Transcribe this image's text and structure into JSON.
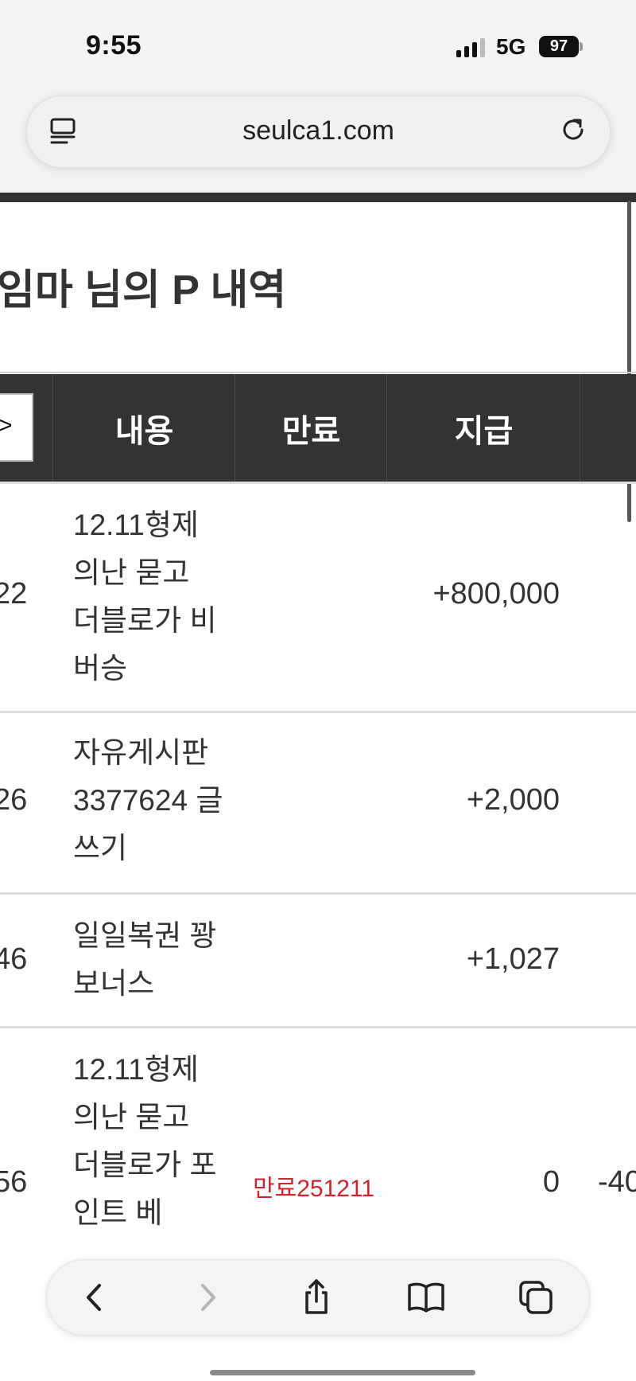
{
  "status_bar": {
    "time": "9:55",
    "network": "5G",
    "battery": "97"
  },
  "browser": {
    "url": "seulca1.com"
  },
  "page": {
    "title": "임마 님의 P 내역"
  },
  "table": {
    "headers": [
      "내용",
      "만료",
      "지급"
    ],
    "rows": [
      {
        "num": "22",
        "content": "12.11형제의난 묻고 더블로가 비버승",
        "expire": "",
        "amount": "+800,000",
        "extra": ""
      },
      {
        "num": "26",
        "content": "자유게시판 3377624 글쓰기",
        "expire": "",
        "amount": "+2,000",
        "extra": ""
      },
      {
        "num": "46",
        "content": "일일복권 꽝 보너스",
        "expire": "",
        "amount": "+1,027",
        "extra": ""
      },
      {
        "num": "56",
        "content": "12.11형제의난 묻고 더블로가 포인트 베",
        "expire": "만료251211",
        "amount": "0",
        "extra": "-40"
      }
    ]
  },
  "icons": {
    "reader": "reader-icon",
    "reload": "reload-icon",
    "back": "chevron-left-icon",
    "forward": "chevron-right-icon",
    "share": "share-icon",
    "bookmarks": "book-icon",
    "tabs": "tabs-icon"
  },
  "colors": {
    "header_bg": "#333333",
    "expire_red": "#d1242f"
  }
}
